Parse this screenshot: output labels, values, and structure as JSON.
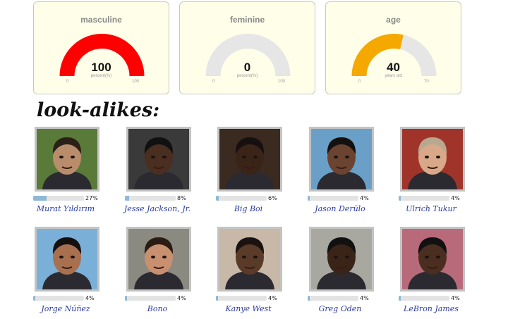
{
  "gauges": [
    {
      "label": "masculine",
      "value": "100",
      "unit": "percent(%)",
      "min": "0",
      "max": "100",
      "fraction": 1.0,
      "color": "#ff0000"
    },
    {
      "label": "feminine",
      "value": "0",
      "unit": "percent(%)",
      "min": "0",
      "max": "100",
      "fraction": 0.0,
      "color": "#ff0000"
    },
    {
      "label": "age",
      "value": "40",
      "unit": "years old",
      "min": "0",
      "max": "70",
      "fraction": 0.571,
      "color": "#f5a800"
    }
  ],
  "heading": "look-alikes:",
  "lookalikes": [
    {
      "name": "Murat Yıldırım",
      "percent": "27%",
      "score": 27,
      "bg": "#5a7a3a",
      "skin": "#b98d6c",
      "hair": "#2a2018"
    },
    {
      "name": "Jesse Jackson, Jr.",
      "percent": "8%",
      "score": 8,
      "bg": "#3a3a3a",
      "skin": "#4a2e20",
      "hair": "#111111"
    },
    {
      "name": "Big Boi",
      "percent": "6%",
      "score": 6,
      "bg": "#3b2a20",
      "skin": "#3a2418",
      "hair": "#181010"
    },
    {
      "name": "Jason Derülo",
      "percent": "4%",
      "score": 4,
      "bg": "#6aa0c8",
      "skin": "#6a4430",
      "hair": "#141010"
    },
    {
      "name": "Ulrich Tukur",
      "percent": "4%",
      "score": 4,
      "bg": "#a0342a",
      "skin": "#d8a888",
      "hair": "#b8a890"
    },
    {
      "name": "Jorge Núñez",
      "percent": "4%",
      "score": 4,
      "bg": "#7ab0d8",
      "skin": "#a8704e",
      "hair": "#151010"
    },
    {
      "name": "Bono",
      "percent": "4%",
      "score": 4,
      "bg": "#8a8a80",
      "skin": "#c89070",
      "hair": "#2a1c14"
    },
    {
      "name": "Kanye West",
      "percent": "4%",
      "score": 4,
      "bg": "#c8b8a8",
      "skin": "#5a3a28",
      "hair": "#1a1210"
    },
    {
      "name": "Greg Oden",
      "percent": "4%",
      "score": 4,
      "bg": "#a8a8a0",
      "skin": "#3a2418",
      "hair": "#111111"
    },
    {
      "name": "LeBron James",
      "percent": "4%",
      "score": 4,
      "bg": "#b86a7a",
      "skin": "#4a2e20",
      "hair": "#111111"
    }
  ]
}
